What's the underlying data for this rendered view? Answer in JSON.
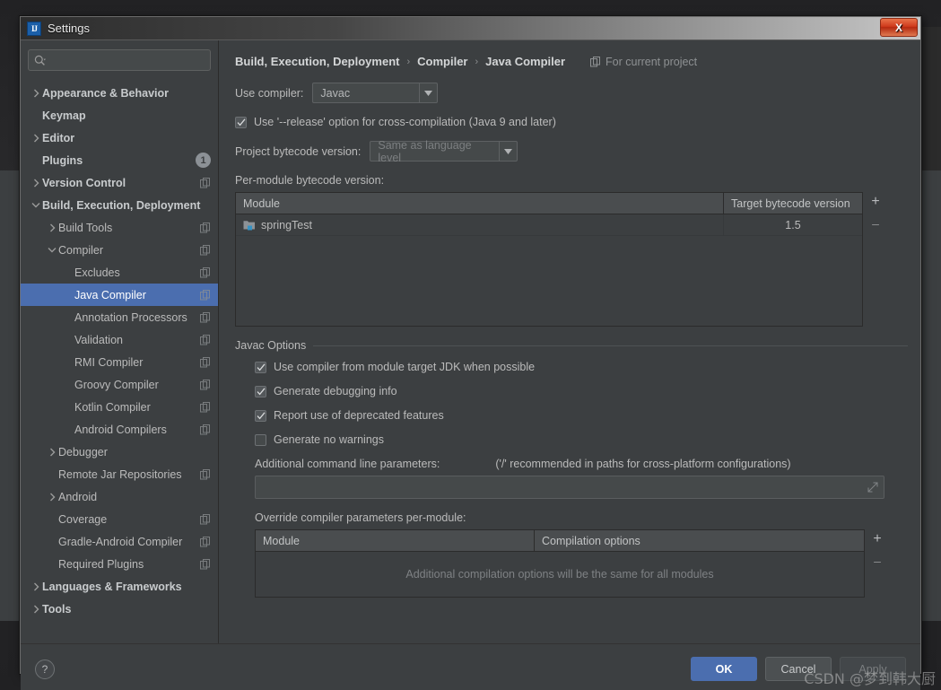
{
  "window": {
    "title": "Settings",
    "app_icon": "intellij-idea-icon",
    "close_label": "X"
  },
  "search": {
    "value": "",
    "placeholder": "",
    "icon": "search-icon"
  },
  "sidebar": {
    "items": [
      {
        "label": "Appearance & Behavior",
        "indent": 0,
        "arrow": "right",
        "bold": true,
        "copy": false,
        "badge": null,
        "selected": false
      },
      {
        "label": "Keymap",
        "indent": 0,
        "arrow": "none",
        "bold": true,
        "copy": false,
        "badge": null,
        "selected": false
      },
      {
        "label": "Editor",
        "indent": 0,
        "arrow": "right",
        "bold": true,
        "copy": false,
        "badge": null,
        "selected": false
      },
      {
        "label": "Plugins",
        "indent": 0,
        "arrow": "none",
        "bold": true,
        "copy": false,
        "badge": "1",
        "selected": false
      },
      {
        "label": "Version Control",
        "indent": 0,
        "arrow": "right",
        "bold": true,
        "copy": true,
        "badge": null,
        "selected": false
      },
      {
        "label": "Build, Execution, Deployment",
        "indent": 0,
        "arrow": "down",
        "bold": true,
        "copy": false,
        "badge": null,
        "selected": false
      },
      {
        "label": "Build Tools",
        "indent": 1,
        "arrow": "right",
        "bold": false,
        "copy": true,
        "badge": null,
        "selected": false
      },
      {
        "label": "Compiler",
        "indent": 1,
        "arrow": "down",
        "bold": false,
        "copy": true,
        "badge": null,
        "selected": false
      },
      {
        "label": "Excludes",
        "indent": 2,
        "arrow": "none",
        "bold": false,
        "copy": true,
        "badge": null,
        "selected": false
      },
      {
        "label": "Java Compiler",
        "indent": 2,
        "arrow": "none",
        "bold": false,
        "copy": true,
        "badge": null,
        "selected": true
      },
      {
        "label": "Annotation Processors",
        "indent": 2,
        "arrow": "none",
        "bold": false,
        "copy": true,
        "badge": null,
        "selected": false
      },
      {
        "label": "Validation",
        "indent": 2,
        "arrow": "none",
        "bold": false,
        "copy": true,
        "badge": null,
        "selected": false
      },
      {
        "label": "RMI Compiler",
        "indent": 2,
        "arrow": "none",
        "bold": false,
        "copy": true,
        "badge": null,
        "selected": false
      },
      {
        "label": "Groovy Compiler",
        "indent": 2,
        "arrow": "none",
        "bold": false,
        "copy": true,
        "badge": null,
        "selected": false
      },
      {
        "label": "Kotlin Compiler",
        "indent": 2,
        "arrow": "none",
        "bold": false,
        "copy": true,
        "badge": null,
        "selected": false
      },
      {
        "label": "Android Compilers",
        "indent": 2,
        "arrow": "none",
        "bold": false,
        "copy": true,
        "badge": null,
        "selected": false
      },
      {
        "label": "Debugger",
        "indent": 1,
        "arrow": "right",
        "bold": false,
        "copy": false,
        "badge": null,
        "selected": false
      },
      {
        "label": "Remote Jar Repositories",
        "indent": 1,
        "arrow": "none",
        "bold": false,
        "copy": true,
        "badge": null,
        "selected": false
      },
      {
        "label": "Android",
        "indent": 1,
        "arrow": "right",
        "bold": false,
        "copy": false,
        "badge": null,
        "selected": false
      },
      {
        "label": "Coverage",
        "indent": 1,
        "arrow": "none",
        "bold": false,
        "copy": true,
        "badge": null,
        "selected": false
      },
      {
        "label": "Gradle-Android Compiler",
        "indent": 1,
        "arrow": "none",
        "bold": false,
        "copy": true,
        "badge": null,
        "selected": false
      },
      {
        "label": "Required Plugins",
        "indent": 1,
        "arrow": "none",
        "bold": false,
        "copy": true,
        "badge": null,
        "selected": false
      },
      {
        "label": "Languages & Frameworks",
        "indent": 0,
        "arrow": "right",
        "bold": true,
        "copy": false,
        "badge": null,
        "selected": false
      },
      {
        "label": "Tools",
        "indent": 0,
        "arrow": "right",
        "bold": true,
        "copy": false,
        "badge": null,
        "selected": false
      }
    ]
  },
  "main": {
    "breadcrumb": {
      "part1": "Build, Execution, Deployment",
      "sep1": "›",
      "part2": "Compiler",
      "sep2": "›",
      "part3": "Java Compiler"
    },
    "for_current_project": "For current project",
    "use_compiler_label": "Use compiler:",
    "use_compiler_value": "Javac",
    "release_option_label": "Use '--release' option for cross-compilation (Java 9 and later)",
    "release_option_checked": true,
    "project_bytecode_label": "Project bytecode version:",
    "project_bytecode_value": "Same as language level",
    "per_module_label": "Per-module bytecode version:",
    "module_table": {
      "columns": [
        "Module",
        "Target bytecode version"
      ],
      "rows": [
        {
          "module": "springTest",
          "target": "1.5"
        }
      ],
      "add_label": "+",
      "remove_label": "–"
    },
    "javac_options": {
      "title": "Javac Options",
      "checkboxes": [
        {
          "label": "Use compiler from module target JDK when possible",
          "checked": true
        },
        {
          "label": "Generate debugging info",
          "checked": true
        },
        {
          "label": "Report use of deprecated features",
          "checked": true
        },
        {
          "label": "Generate no warnings",
          "checked": false
        }
      ],
      "additional_params_label": "Additional command line parameters:",
      "additional_params_hint": "('/' recommended in paths for cross-platform configurations)",
      "additional_params_value": "",
      "override_label": "Override compiler parameters per-module:",
      "override_table": {
        "columns": [
          "Module",
          "Compilation options"
        ],
        "empty_text": "Additional compilation options will be the same for all modules",
        "add_label": "+",
        "remove_label": "–"
      }
    }
  },
  "footer": {
    "help_label": "?",
    "ok_label": "OK",
    "cancel_label": "Cancel",
    "apply_label": "Apply"
  },
  "watermark": "CSDN @梦到韩大厨",
  "colors": {
    "panel_bg": "#3c3f41",
    "selection": "#4b6eaf",
    "text": "#bbbbbb",
    "accent_blue": "#4b6eaf",
    "close_red": "#cf3a1c"
  }
}
